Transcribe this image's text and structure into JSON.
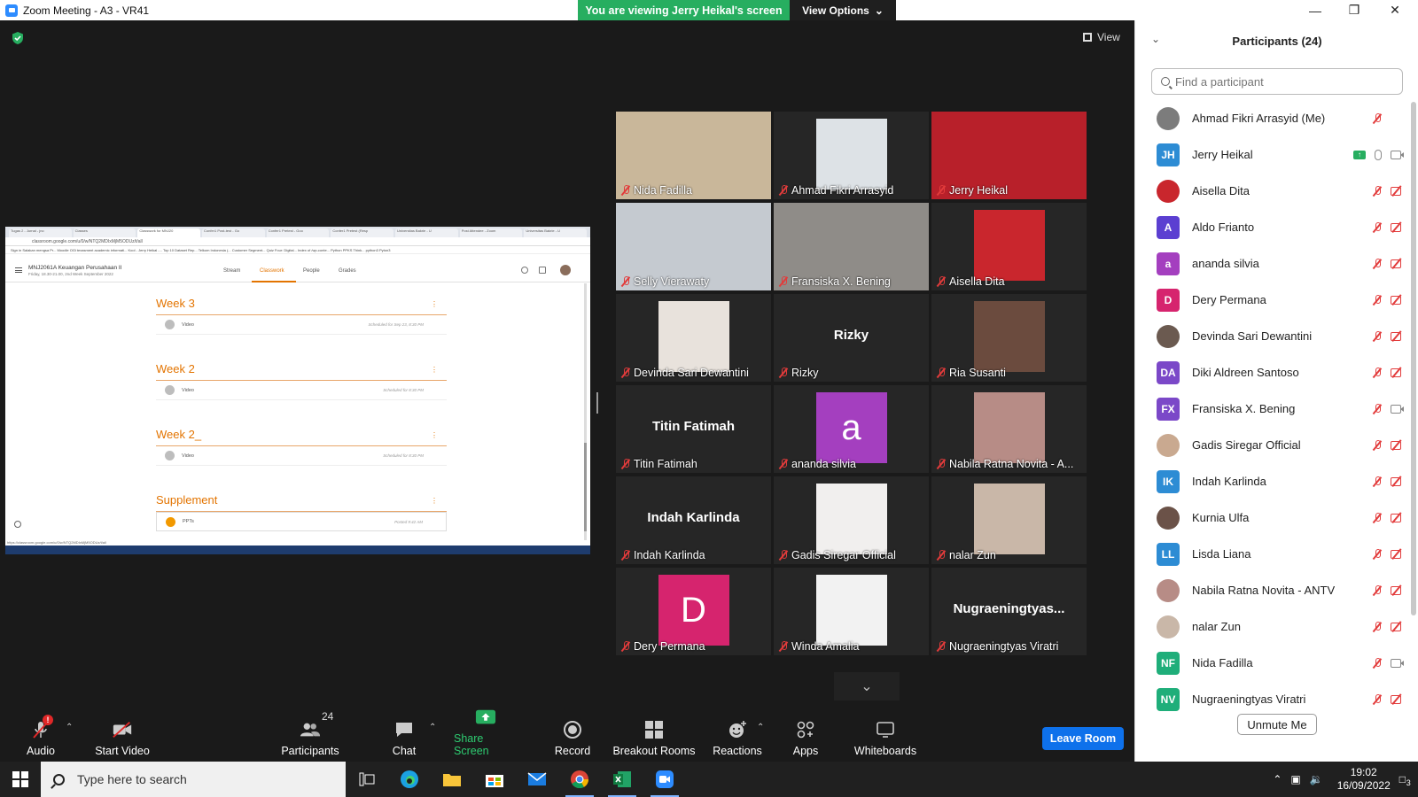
{
  "window": {
    "title": "Zoom Meeting - A3 - VR41",
    "viewing_banner": "You are viewing Jerry Heikal's screen",
    "view_options": "View Options",
    "view_label": "View"
  },
  "shared_screen": {
    "browser_tabs": [
      "Tugas 2 - Jurnal - jno",
      "Classes",
      "Classwork for MNJ20",
      "Confer1 Post-test - Go",
      "Confer1 Pretest - Goo",
      "Confer1 Pretest (Resp",
      "Universitas Bakrie - U",
      "Post Attendee - Zoom",
      "Universitas Bakrie - U"
    ],
    "address": "classroom.google.com/u/0/w/NTQ2MDIxMjM5ODUz/t/all",
    "bookmarks": "Sign in   Salakan mengsa Pr...   Moodle OGi   texasment   academic informati...   Kool - Jerry Heikal -...   Top 10 Dataset Rep...   Telkom Indonesia (...   Customer Segment...   Quiz Four: Digital...   Index of /wp-conte...   Python PPKS Think...   python3   Pyton3",
    "course_title": "MNJ2061A Keuangan Perusahaan II",
    "course_subtitle": "Friday, 18.30-21.00, 2nd Week September 2022",
    "nav_tabs": [
      "Stream",
      "Classwork",
      "People",
      "Grades"
    ],
    "active_tab": "Classwork",
    "sections": [
      {
        "title": "Week 3",
        "item": "Video",
        "schedule": "Scheduled for Sep 23, 8:30 PM"
      },
      {
        "title": "Week 2",
        "item": "Video",
        "schedule": "Scheduled for 8:30 PM"
      },
      {
        "title": "Week 2_",
        "item": "Video",
        "schedule": "Scheduled for 8:30 PM"
      },
      {
        "title": "Supplement",
        "item": "PPTs",
        "schedule": "Posted 9:42 AM"
      }
    ],
    "status_url": "https://classroom.google.com/u/0/w/NTQ2MDIxMjM5ODUz/t/all"
  },
  "video_tiles": [
    {
      "name": "Nida Fadilla",
      "kind": "photo",
      "color": "#c9b79a"
    },
    {
      "name": "Ahmad Fikri Arrasyid",
      "kind": "thumb",
      "color": "#dde2e6"
    },
    {
      "name": "Jerry Heikal",
      "kind": "photo",
      "color": "#b8202a",
      "active": true
    },
    {
      "name": "Selly Vierawaty",
      "kind": "photo",
      "color": "#c5cad0"
    },
    {
      "name": "Fransiska X. Bening",
      "kind": "photo",
      "color": "#8f8c88"
    },
    {
      "name": "Aisella Dita",
      "kind": "thumb",
      "color": "#c9262d"
    },
    {
      "name": "Devinda Sari Dewantini",
      "kind": "thumb",
      "color": "#e8e2dc"
    },
    {
      "name": "Rizky",
      "kind": "text",
      "center": "Rizky"
    },
    {
      "name": "Ria Susanti",
      "kind": "thumb",
      "color": "#6b4b3e"
    },
    {
      "name": "Titin Fatimah",
      "kind": "text",
      "center": "Titin Fatimah"
    },
    {
      "name": "ananda silvia",
      "kind": "letter",
      "letter": "a",
      "color": "#a43fbf"
    },
    {
      "name": "Nabila Ratna Novita - A...",
      "kind": "thumb",
      "color": "#b78c86"
    },
    {
      "name": "Indah Karlinda",
      "kind": "text",
      "center": "Indah Karlinda"
    },
    {
      "name": "Gadis Siregar Official",
      "kind": "thumb",
      "color": "#f1efee"
    },
    {
      "name": "nalar Zun",
      "kind": "thumb",
      "color": "#c9b7a8"
    },
    {
      "name": "Dery Permana",
      "kind": "letter",
      "letter": "D",
      "color": "#d6246e"
    },
    {
      "name": "Winda Amalia",
      "kind": "thumb",
      "color": "#f2f2f2"
    },
    {
      "name": "Nugraeningtyas Viratri",
      "kind": "text",
      "center": "Nugraeningtyas..."
    }
  ],
  "toolbar": {
    "audio": "Audio",
    "audio_badge": "!",
    "start_video": "Start Video",
    "participants": "Participants",
    "participants_count": "24",
    "chat": "Chat",
    "share_screen": "Share Screen",
    "record": "Record",
    "breakout_rooms": "Breakout Rooms",
    "reactions": "Reactions",
    "apps": "Apps",
    "whiteboards": "Whiteboards",
    "leave": "Leave Room"
  },
  "participants_panel": {
    "title": "Participants (24)",
    "search_placeholder": "Find a participant",
    "unmute_me": "Unmute Me",
    "list": [
      {
        "name": "Ahmad Fikri Arrasyid (Me)",
        "avatar": "",
        "color": "#7c7c7c",
        "photo": true,
        "mic": "off",
        "video": "none"
      },
      {
        "name": "Jerry Heikal",
        "avatar": "JH",
        "color": "#2d8cd4",
        "mic": "on",
        "video": "on",
        "sharing": true
      },
      {
        "name": "Aisella Dita",
        "avatar": "",
        "color": "#c9262d",
        "photo": true,
        "mic": "off",
        "video": "off"
      },
      {
        "name": "Aldo Frianto",
        "avatar": "A",
        "color": "#5b3fd1",
        "mic": "off",
        "video": "off"
      },
      {
        "name": "ananda silvia",
        "avatar": "a",
        "color": "#a43fbf",
        "mic": "off",
        "video": "off"
      },
      {
        "name": "Dery Permana",
        "avatar": "D",
        "color": "#d6246e",
        "mic": "off",
        "video": "off"
      },
      {
        "name": "Devinda Sari Dewantini",
        "avatar": "",
        "color": "#6b5a50",
        "photo": true,
        "mic": "off",
        "video": "off"
      },
      {
        "name": "Diki Aldreen Santoso",
        "avatar": "DA",
        "color": "#7b48c8",
        "mic": "off",
        "video": "off"
      },
      {
        "name": "Fransiska X. Bening",
        "avatar": "FX",
        "color": "#7b48c8",
        "mic": "off",
        "video": "on"
      },
      {
        "name": "Gadis Siregar Official",
        "avatar": "",
        "color": "#c9a990",
        "photo": true,
        "mic": "off",
        "video": "off"
      },
      {
        "name": "Indah Karlinda",
        "avatar": "IK",
        "color": "#2d8cd4",
        "mic": "off",
        "video": "off"
      },
      {
        "name": "Kurnia Ulfa",
        "avatar": "",
        "color": "#6b5248",
        "photo": true,
        "mic": "off",
        "video": "off"
      },
      {
        "name": "Lisda Liana",
        "avatar": "LL",
        "color": "#2d8cd4",
        "mic": "off",
        "video": "off"
      },
      {
        "name": "Nabila Ratna Novita - ANTV",
        "avatar": "",
        "color": "#b78c86",
        "photo": true,
        "mic": "off",
        "video": "off"
      },
      {
        "name": "nalar Zun",
        "avatar": "",
        "color": "#c9b7a8",
        "photo": true,
        "mic": "off",
        "video": "off"
      },
      {
        "name": "Nida Fadilla",
        "avatar": "NF",
        "color": "#1fae7a",
        "mic": "off",
        "video": "on"
      },
      {
        "name": "Nugraeningtyas Viratri",
        "avatar": "NV",
        "color": "#1fae7a",
        "mic": "off",
        "video": "off"
      }
    ]
  },
  "taskbar": {
    "search_placeholder": "Type here to search",
    "time": "19:02",
    "date": "16/09/2022",
    "notifications": "3"
  }
}
